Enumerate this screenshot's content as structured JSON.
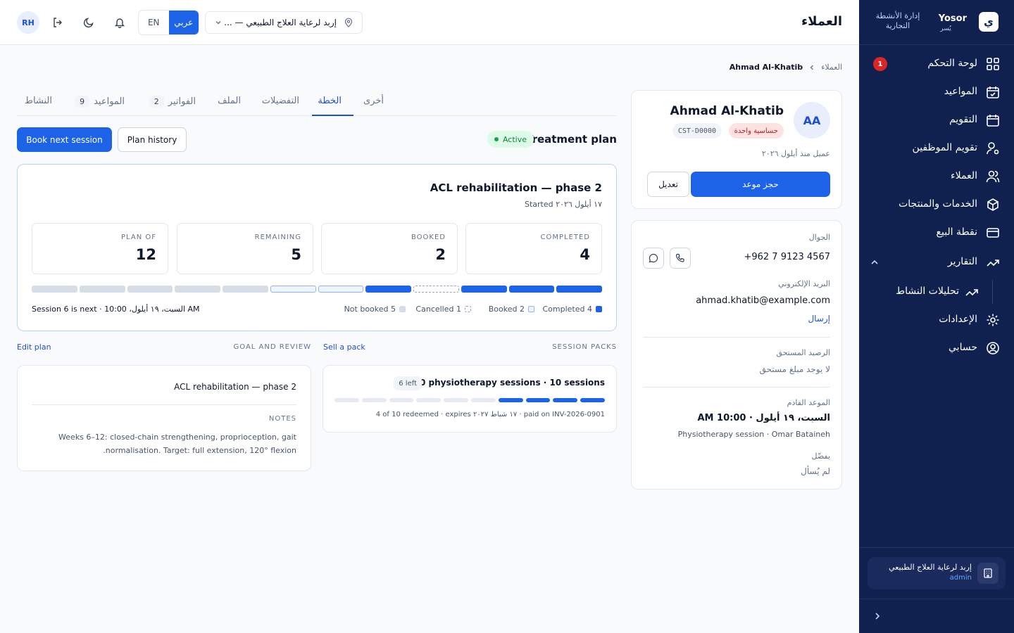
{
  "sidebar": {
    "brand_name": "Yosor",
    "brand_sub": "يُسر",
    "brand_title": "إدارة الأنشطة التجارية",
    "items": [
      {
        "label": "لوحة التحكم",
        "badge": "1"
      },
      {
        "label": "المواعيد"
      },
      {
        "label": "التقويم"
      },
      {
        "label": "تقويم الموظفين"
      },
      {
        "label": "العملاء"
      },
      {
        "label": "الخدمات والمنتجات"
      },
      {
        "label": "نقطة البيع"
      },
      {
        "label": "التقارير"
      },
      {
        "label": "تحليلات النشاط"
      },
      {
        "label": "الإعدادات"
      },
      {
        "label": "حسابي"
      }
    ],
    "workspace": {
      "name": "إربد لرعاية العلاج الطبيعي",
      "role": "admin"
    }
  },
  "topbar": {
    "title": "العملاء",
    "branch": "إربد لرعاية العلاج الطبيعي — ...",
    "lang_ar": "عربي",
    "lang_en": "EN",
    "avatar": "RH"
  },
  "breadcrumb": {
    "parent": "العملاء",
    "current": "Ahmad Al-Khatib"
  },
  "profile": {
    "initials": "AA",
    "name": "Ahmad Al-Khatib",
    "tag": "حساسية واحدة",
    "id": "CST-D0000",
    "since": "عميل منذ أيلول ٢٠٢٦",
    "book": "حجز موعد",
    "edit": "تعديل"
  },
  "contact": {
    "mobile_label": "الجوال",
    "mobile": "+962 7 9123 4567",
    "email_label": "البريد الإلكتروني",
    "email": "ahmad.khatib@example.com",
    "send": "إرسال",
    "balance_label": "الرصيد المستحق",
    "balance": "لا يوجد مبلغ مستحق",
    "next_label": "الموعد القادم",
    "next_time": "السبت، ١٩ أيلول · 10:00 AM",
    "next_detail": "Physiotherapy session · Omar Bataineh",
    "prefers_label": "يفضّل",
    "prefers": "لم يُسأل"
  },
  "tabs": [
    {
      "label": "أخرى"
    },
    {
      "label": "الخطة"
    },
    {
      "label": "التفضيلات"
    },
    {
      "label": "الملف"
    },
    {
      "label": "الفواتير",
      "count": "2"
    },
    {
      "label": "المواعيد",
      "count": "9"
    },
    {
      "label": "النشاط"
    }
  ],
  "treatment": {
    "title": "Treatment plan",
    "status": "Active",
    "book_next": "Book next session",
    "history": "Plan history",
    "plan_name": "ACL rehabilitation — phase 2",
    "started": "Started ١٧ أيلول ٢٠٢٦",
    "stats": [
      {
        "label": "COMPLETED",
        "value": "4"
      },
      {
        "label": "BOOKED",
        "value": "2"
      },
      {
        "label": "REMAINING",
        "value": "5"
      },
      {
        "label": "PLAN OF",
        "value": "12"
      }
    ],
    "legend": [
      {
        "label": "Completed 4"
      },
      {
        "label": "Booked 2"
      },
      {
        "label": "Cancelled 1"
      },
      {
        "label": "Not booked 5"
      }
    ],
    "next": "Session 6 is next · السبت، ١٩ أيلول، 10:00 AM",
    "segments": [
      "done",
      "done",
      "done",
      "cancel",
      "done",
      "booked",
      "booked",
      "none",
      "none",
      "none",
      "none",
      "none"
    ]
  },
  "packs": {
    "header": "SESSION PACKS",
    "link": "Sell a pack",
    "title": "10 physiotherapy sessions · 10 sessions",
    "left": "6 left",
    "meta": "4 of 10 redeemed · expires ١٧ شباط ٢٠٢٧ · paid on INV-2026-0901",
    "used": 4,
    "total": 10
  },
  "goal": {
    "header": "GOAL AND REVIEW",
    "link": "Edit plan",
    "title": "ACL rehabilitation — phase 2",
    "notes_label": "NOTES",
    "notes": "Weeks 6–12: closed-chain strengthening, proprioception, gait normalisation. Target: full extension, 120° flexion."
  },
  "colors": {
    "sidebar": "#10204f",
    "primary": "#1d63e8",
    "danger": "#dc2626"
  }
}
